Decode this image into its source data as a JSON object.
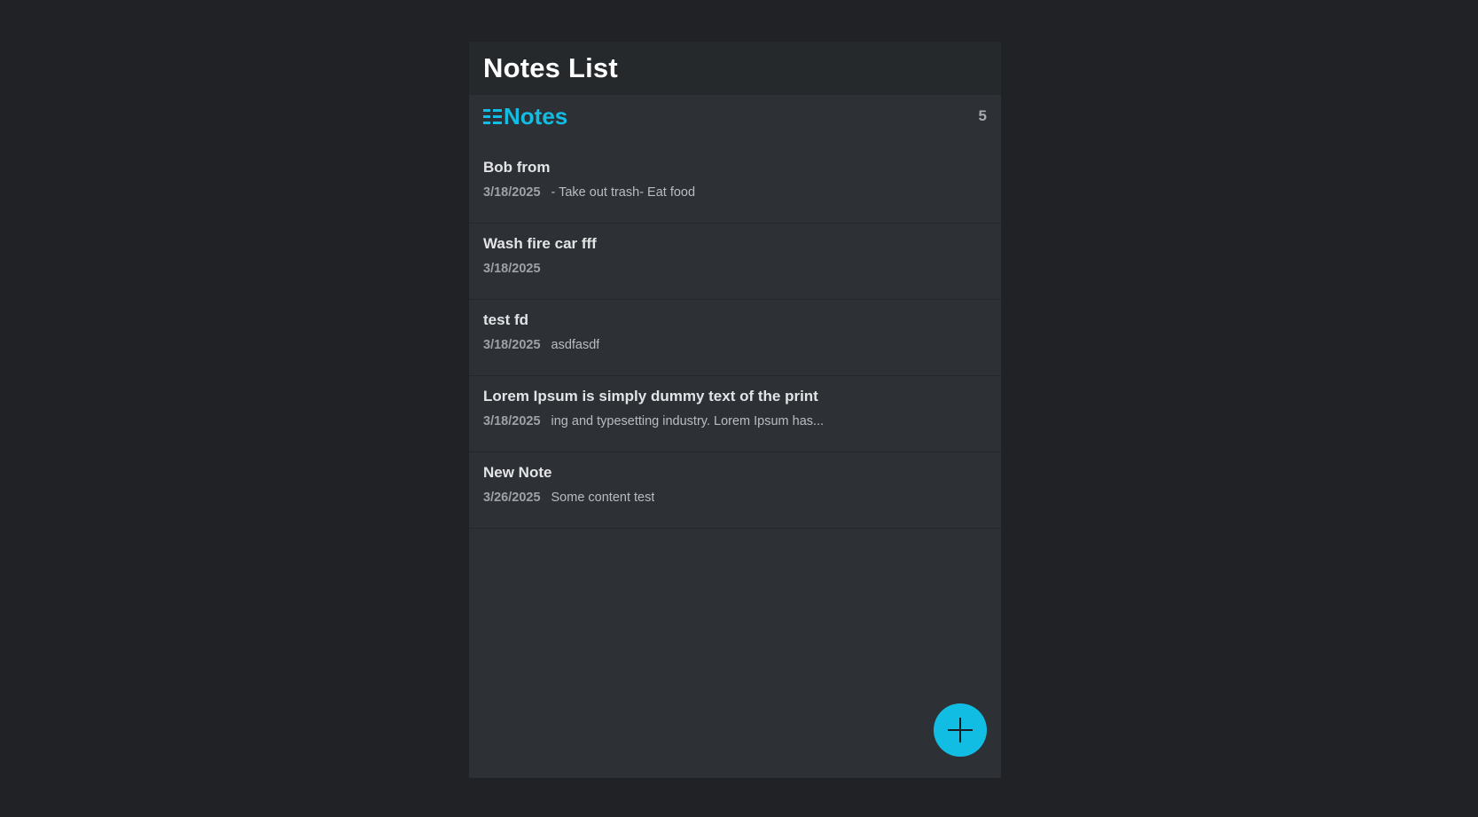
{
  "app": {
    "title": "Notes List"
  },
  "section": {
    "title": "Notes",
    "icon": "list-icon",
    "count": "5"
  },
  "notes": [
    {
      "title": "Bob from",
      "date": "3/18/2025",
      "snippet": "- Take out trash- Eat food"
    },
    {
      "title": "Wash fire car fff",
      "date": "3/18/2025",
      "snippet": ""
    },
    {
      "title": "test fd",
      "date": "3/18/2025",
      "snippet": "asdfasdf"
    },
    {
      "title": "Lorem Ipsum is simply dummy text of the print",
      "date": "3/18/2025",
      "snippet": "ing and typesetting industry. Lorem Ipsum has..."
    },
    {
      "title": "New Note",
      "date": "3/26/2025",
      "snippet": "Some content test"
    }
  ],
  "fab": {
    "icon": "plus-icon"
  },
  "colors": {
    "background": "#202226",
    "panel": "#2d3135",
    "header": "#26292c",
    "accent": "#12bde3"
  }
}
